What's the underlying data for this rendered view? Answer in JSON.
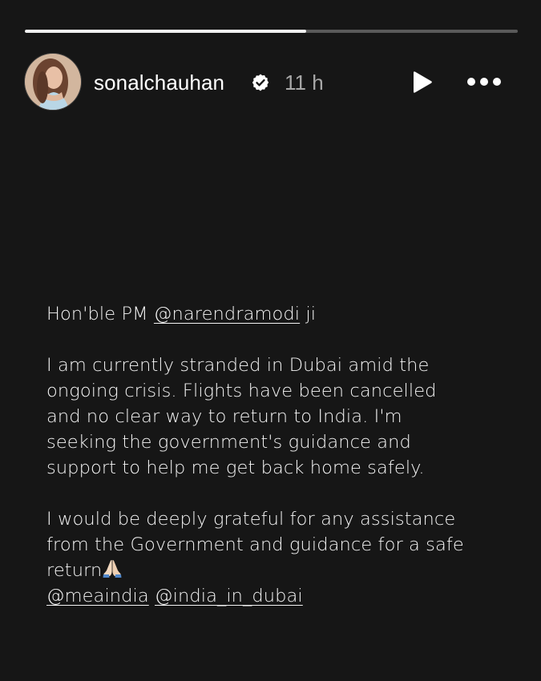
{
  "story": {
    "progress_fraction": 0.57,
    "username": "sonalchauhan",
    "time": "11 h",
    "verified_icon": "verified-badge-icon",
    "play_icon": "play-icon",
    "more_icon": "more-options-icon"
  },
  "post": {
    "greeting_prefix": "Hon'ble PM ",
    "greeting_mention": "@narendramodi",
    "greeting_suffix": " ji",
    "body_para1_line1": "I am currently stranded in Dubai amid the",
    "body_para1_line2": "ongoing crisis. Flights have been cancelled",
    "body_para1_line3": "and no clear way  to return to India. I'm",
    "body_para1_line4": "seeking the government's guidance and",
    "body_para1_line5": "support to help me get back home safely.",
    "body_para2_line1": "I would be deeply grateful for any assistance",
    "body_para2_line2": "from the Government and guidance for a safe",
    "body_para2_line3": "return",
    "emoji": "folded-hands-emoji",
    "mention_1": "@meaindia",
    "mention_2": "@india_in_dubai"
  },
  "colors": {
    "background": "#161616",
    "text": "#f4f4f4",
    "muted": "#a8a8a8",
    "progress_track": "#5a5a5a",
    "progress_fill": "#f2f2f2"
  }
}
